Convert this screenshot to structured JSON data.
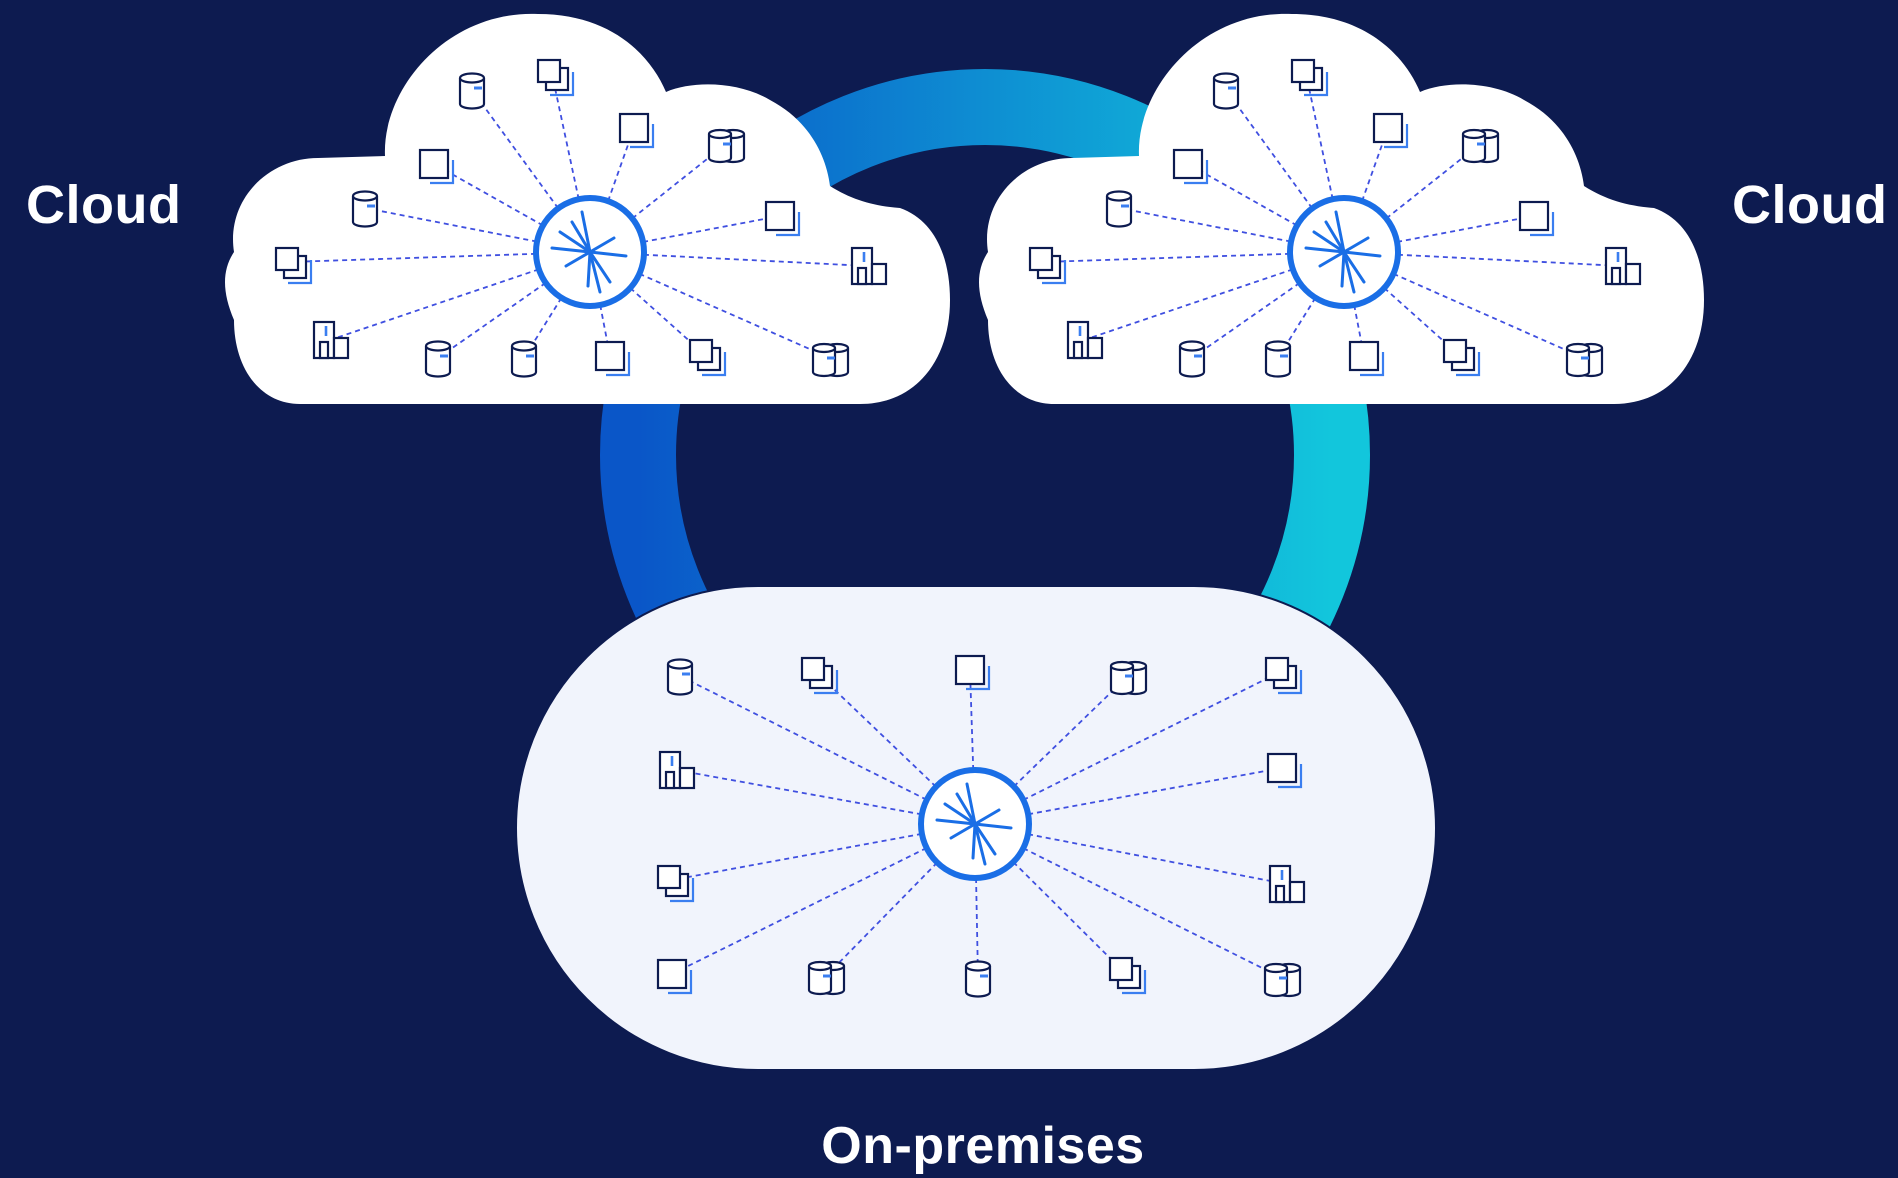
{
  "labels": {
    "left": "Cloud",
    "right": "Cloud",
    "bottom": "On-premises"
  },
  "colors": {
    "background": "#0d1b50",
    "ring_start": "#0a56c8",
    "ring_end": "#12c6dc",
    "cloud_fill": "#ffffff",
    "premises_fill": "#f1f4fc",
    "icon_stroke": "#0d1b50",
    "icon_accent": "#3a7ef0",
    "link_dash": "#3f4fe0",
    "hub_ring": "#1a6ee6"
  },
  "groups": [
    {
      "id": "cloud-left",
      "label": "Cloud",
      "hub": "hub-icon",
      "nodes": [
        "cylinder-icon",
        "stack-icon",
        "square-icon",
        "double-cylinder-icon",
        "square-icon",
        "cylinder-icon",
        "square-icon",
        "stack-icon",
        "building-icon",
        "building-icon",
        "cylinder-icon",
        "cylinder-icon",
        "square-icon",
        "stack-icon",
        "double-cylinder-icon"
      ]
    },
    {
      "id": "cloud-right",
      "label": "Cloud",
      "hub": "hub-icon",
      "nodes": [
        "cylinder-icon",
        "stack-icon",
        "square-icon",
        "double-cylinder-icon",
        "square-icon",
        "cylinder-icon",
        "square-icon",
        "stack-icon",
        "building-icon",
        "building-icon",
        "cylinder-icon",
        "cylinder-icon",
        "square-icon",
        "stack-icon",
        "double-cylinder-icon"
      ]
    },
    {
      "id": "on-premises",
      "label": "On-premises",
      "hub": "hub-icon",
      "nodes": [
        "cylinder-icon",
        "stack-icon",
        "square-icon",
        "double-cylinder-icon",
        "stack-icon",
        "building-icon",
        "square-icon",
        "stack-icon",
        "building-icon",
        "square-icon",
        "double-cylinder-icon",
        "cylinder-icon",
        "stack-icon",
        "double-cylinder-icon"
      ]
    }
  ]
}
